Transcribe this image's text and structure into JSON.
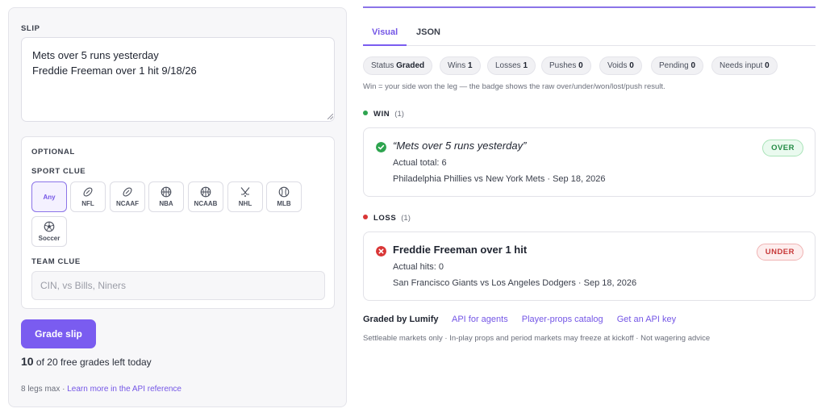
{
  "slip": {
    "label": "SLIP",
    "text": "Mets over 5 runs yesterday\nFreddie Freeman over 1 hit 9/18/26"
  },
  "optional": {
    "label": "OPTIONAL",
    "sport_clue_label": "SPORT CLUE",
    "sports": [
      {
        "label": "Any",
        "icon": "none",
        "selected": true
      },
      {
        "label": "NFL",
        "icon": "football-icon"
      },
      {
        "label": "NCAAF",
        "icon": "football-icon"
      },
      {
        "label": "NBA",
        "icon": "basketball-icon"
      },
      {
        "label": "NCAAB",
        "icon": "basketball-icon"
      },
      {
        "label": "NHL",
        "icon": "hockey-sticks-icon"
      },
      {
        "label": "MLB",
        "icon": "baseball-icon"
      },
      {
        "label": "Soccer",
        "icon": "soccer-ball-icon"
      }
    ],
    "team_clue_label": "TEAM CLUE",
    "team_placeholder": "CIN, vs Bills, Niners"
  },
  "actions": {
    "grade_button": "Grade slip",
    "grades_used": "10",
    "grades_rest": "of 20 free grades left today"
  },
  "footnote": {
    "text": "8 legs max · ",
    "link": "Learn more in the API reference"
  },
  "colors": {
    "accent": "#7a5cf0",
    "win": "#2ea44f",
    "loss": "#d93636"
  },
  "tabs": [
    {
      "label": "Visual",
      "active": true
    },
    {
      "label": "JSON",
      "active": false
    }
  ],
  "stats": [
    {
      "label": "Status",
      "value": "Graded"
    },
    {
      "label": "Wins",
      "value": "1"
    },
    {
      "label": "Losses",
      "value": "1"
    },
    {
      "label": "Pushes",
      "value": "0"
    },
    {
      "label": "Voids",
      "value": "0"
    },
    {
      "label": "Pending",
      "value": "0"
    },
    {
      "label": "Needs input",
      "value": "0"
    }
  ],
  "legend_note": "Win = your side won the leg — the badge shows the raw over/under/won/lost/push result.",
  "groups": {
    "win": {
      "label": "WIN",
      "count": "(1)",
      "leg": {
        "title": "“Mets over 5 runs yesterday”",
        "actual": "Actual total: 6",
        "match": "Philadelphia Phillies vs New York Mets · Sep 18, 2026",
        "badge": "OVER",
        "icon": "check-circle-icon"
      }
    },
    "loss": {
      "label": "LOSS",
      "count": "(1)",
      "leg": {
        "title": "Freddie Freeman over 1 hit",
        "actual": "Actual hits: 0",
        "match": "San Francisco Giants vs Los Angeles Dodgers · Sep 18, 2026",
        "badge": "UNDER",
        "icon": "x-circle-icon"
      }
    }
  },
  "footer": {
    "brand": "Graded by Lumify",
    "links": [
      "API for agents",
      "Player-props catalog",
      "Get an API key"
    ],
    "disclaimer": "Settleable markets only · In-play props and period markets may freeze at kickoff · Not wagering advice"
  }
}
